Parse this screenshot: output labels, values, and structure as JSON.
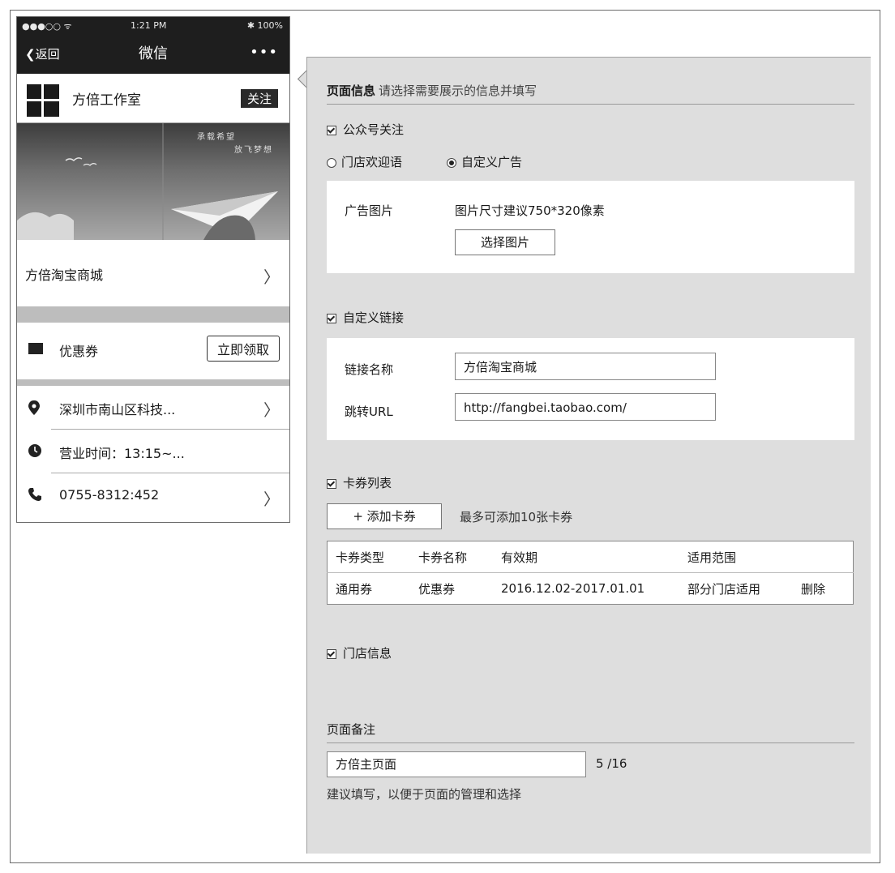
{
  "phone": {
    "status": {
      "signal": "●●●○○ ᯤ",
      "time": "1:21 PM",
      "battery": "✱ 100%"
    },
    "nav": {
      "back": "返回",
      "title": "微信",
      "more": "•••"
    },
    "account": {
      "name": "方倍工作室",
      "follow": "关注"
    },
    "banner": {
      "line1": "承载希望",
      "line2": "放飞梦想"
    },
    "shop": {
      "label": "方倍淘宝商城"
    },
    "coupon": {
      "label": "优惠券",
      "button": "立即领取"
    },
    "store": {
      "address": "深圳市南山区科技...",
      "hours": "营业时间：13:15~...",
      "phone": "0755-8312:452"
    }
  },
  "panel": {
    "page_info": {
      "title": "页面信息",
      "hint": "请选择需要展示的信息并填写"
    },
    "follow_option": "公众号关注",
    "radio_welcome": "门店欢迎语",
    "radio_ad": "自定义广告",
    "ad": {
      "label": "广告图片",
      "hint": "图片尺寸建议750*320像素",
      "button": "选择图片"
    },
    "custom_link": {
      "title": "自定义链接",
      "name_label": "链接名称",
      "name_value": "方倍淘宝商城",
      "url_label": "跳转URL",
      "url_value": "http://fangbei.taobao.com/"
    },
    "cards": {
      "title": "卡券列表",
      "add_button": "+ 添加卡券",
      "limit": "最多可添加10张卡券",
      "headers": [
        "卡券类型",
        "卡券名称",
        "有效期",
        "适用范围"
      ],
      "row": {
        "type": "通用券",
        "name": "优惠券",
        "validity": "2016.12.02-2017.01.01",
        "scope": "部分门店适用",
        "delete": "删除"
      }
    },
    "store_info": "门店信息",
    "note": {
      "title": "页面备注",
      "value": "方倍主页面",
      "count": "5 /16",
      "hint": "建议填写，以便于页面的管理和选择"
    }
  }
}
